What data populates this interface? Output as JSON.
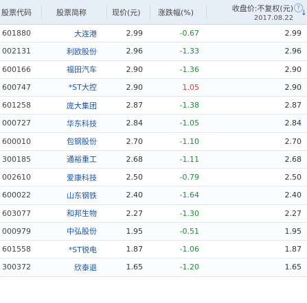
{
  "headers": {
    "code": "股票代码",
    "name": "股票简称",
    "price": "现价(元)",
    "change": "涨跌幅(%)",
    "close_label": "收盘价:不复权(元)",
    "close_date": "2017.08.22",
    "help_glyph": "?",
    "sort_glyph": "↓"
  },
  "rows": [
    {
      "code": "601880",
      "name": "大连港",
      "price": "2.99",
      "change": "-0.67",
      "close": "2.99",
      "dir": "neg"
    },
    {
      "code": "002131",
      "name": "利欧股份",
      "price": "2.96",
      "change": "-1.33",
      "close": "2.96",
      "dir": "neg"
    },
    {
      "code": "600166",
      "name": "福田汽车",
      "price": "2.90",
      "change": "-1.36",
      "close": "2.90",
      "dir": "neg"
    },
    {
      "code": "600747",
      "name": "*ST大控",
      "price": "2.90",
      "change": "1.05",
      "close": "2.90",
      "dir": "pos"
    },
    {
      "code": "601258",
      "name": "庞大集团",
      "price": "2.87",
      "change": "-1.38",
      "close": "2.87",
      "dir": "neg"
    },
    {
      "code": "000727",
      "name": "华东科技",
      "price": "2.84",
      "change": "-1.05",
      "close": "2.84",
      "dir": "neg"
    },
    {
      "code": "600010",
      "name": "包钢股份",
      "price": "2.70",
      "change": "-1.10",
      "close": "2.70",
      "dir": "neg"
    },
    {
      "code": "300185",
      "name": "通裕重工",
      "price": "2.68",
      "change": "-1.11",
      "close": "2.68",
      "dir": "neg"
    },
    {
      "code": "002610",
      "name": "爱康科技",
      "price": "2.50",
      "change": "-0.79",
      "close": "2.50",
      "dir": "neg"
    },
    {
      "code": "600022",
      "name": "山东钢铁",
      "price": "2.40",
      "change": "-1.64",
      "close": "2.40",
      "dir": "neg"
    },
    {
      "code": "603077",
      "name": "和邦生物",
      "price": "2.27",
      "change": "-1.30",
      "close": "2.27",
      "dir": "neg"
    },
    {
      "code": "000979",
      "name": "中弘股份",
      "price": "1.95",
      "change": "-0.51",
      "close": "1.95",
      "dir": "neg"
    },
    {
      "code": "601558",
      "name": "*ST锐电",
      "price": "1.87",
      "change": "-1.06",
      "close": "1.87",
      "dir": "neg"
    },
    {
      "code": "300372",
      "name": "欣泰退",
      "price": "1.65",
      "change": "-1.20",
      "close": "1.65",
      "dir": "neg"
    }
  ]
}
